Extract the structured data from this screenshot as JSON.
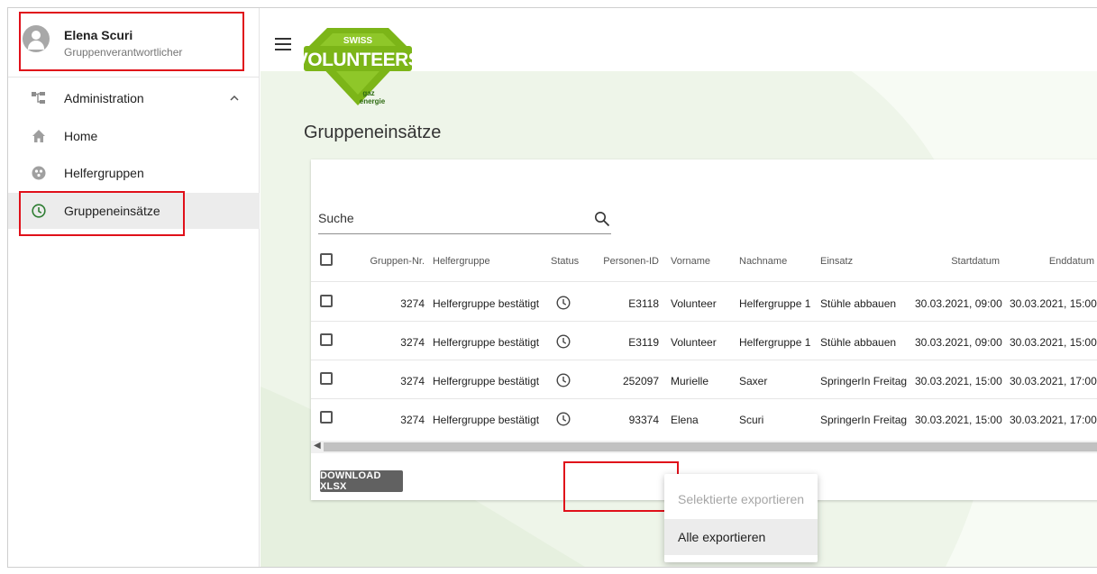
{
  "user": {
    "name": "Elena Scuri",
    "role": "Gruppenverantwortlicher"
  },
  "sidebar": {
    "items": [
      {
        "label": "Administration",
        "icon": "sitemap-icon"
      },
      {
        "label": "Home",
        "icon": "home-icon"
      },
      {
        "label": "Helfergruppen",
        "icon": "group-icon"
      },
      {
        "label": "Gruppeneinsätze",
        "icon": "clock-icon"
      }
    ]
  },
  "page": {
    "title": "Gruppeneinsätze"
  },
  "search": {
    "label": "Suche"
  },
  "table": {
    "headers": [
      "Gruppen-Nr.",
      "Helfergruppe",
      "Status",
      "Personen-ID",
      "Vorname",
      "Nachname",
      "Einsatz",
      "Startdatum",
      "Enddatum"
    ],
    "rows": [
      {
        "gruppen_nr": "3274",
        "helfergruppe": "Helfergruppe bestätigt",
        "personen_id": "E3118",
        "vorname": "Volunteer",
        "nachname": "Helfergruppe 1",
        "einsatz": "Stühle abbauen",
        "start": "30.03.2021, 09:00",
        "ende": "30.03.2021, 15:00"
      },
      {
        "gruppen_nr": "3274",
        "helfergruppe": "Helfergruppe bestätigt",
        "personen_id": "E3119",
        "vorname": "Volunteer",
        "nachname": "Helfergruppe 1",
        "einsatz": "Stühle abbauen",
        "start": "30.03.2021, 09:00",
        "ende": "30.03.2021, 15:00"
      },
      {
        "gruppen_nr": "3274",
        "helfergruppe": "Helfergruppe bestätigt",
        "personen_id": "252097",
        "vorname": "Murielle",
        "nachname": "Saxer",
        "einsatz": "SpringerIn Freitag",
        "start": "30.03.2021, 15:00",
        "ende": "30.03.2021, 17:00"
      },
      {
        "gruppen_nr": "3274",
        "helfergruppe": "Helfergruppe bestätigt",
        "personen_id": "93374",
        "vorname": "Elena",
        "nachname": "Scuri",
        "einsatz": "SpringerIn Freitag",
        "start": "30.03.2021, 15:00",
        "ende": "30.03.2021, 17:00"
      }
    ]
  },
  "download": {
    "label": "DOWNLOAD XLSX"
  },
  "export_menu": {
    "selected_label": "Selektierte exportieren",
    "all_label": "Alle exportieren"
  },
  "colors": {
    "highlight": "#e0101a",
    "accent_green": "#2e7d32",
    "logo_green": "#7cb518"
  }
}
